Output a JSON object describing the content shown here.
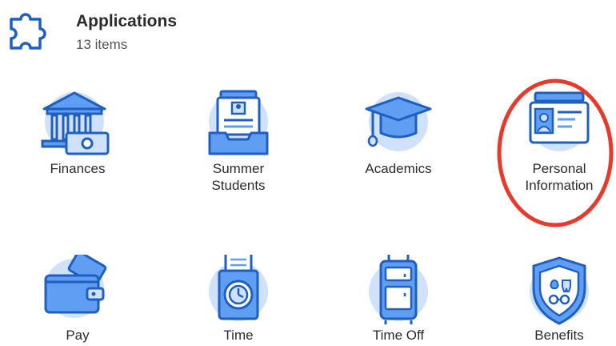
{
  "header": {
    "title": "Applications",
    "count": "13 items",
    "icon": "puzzle-icon"
  },
  "apps": [
    {
      "label": "Finances",
      "icon": "bank-icon"
    },
    {
      "label": "Summer Students",
      "icon": "card-inbox-icon"
    },
    {
      "label": "Academics",
      "icon": "graduation-cap-icon"
    },
    {
      "label": "Personal Information",
      "icon": "id-card-icon"
    },
    {
      "label": "Pay",
      "icon": "wallet-icon"
    },
    {
      "label": "Time",
      "icon": "time-clock-icon"
    },
    {
      "label": "Time Off",
      "icon": "suitcase-icon"
    },
    {
      "label": "Benefits",
      "icon": "shield-icon"
    }
  ],
  "colors": {
    "icon_dark": "#1f5fbf",
    "icon_mid": "#5f9ef2",
    "icon_light": "#cfe1fb",
    "highlight": "#e53b2c"
  }
}
